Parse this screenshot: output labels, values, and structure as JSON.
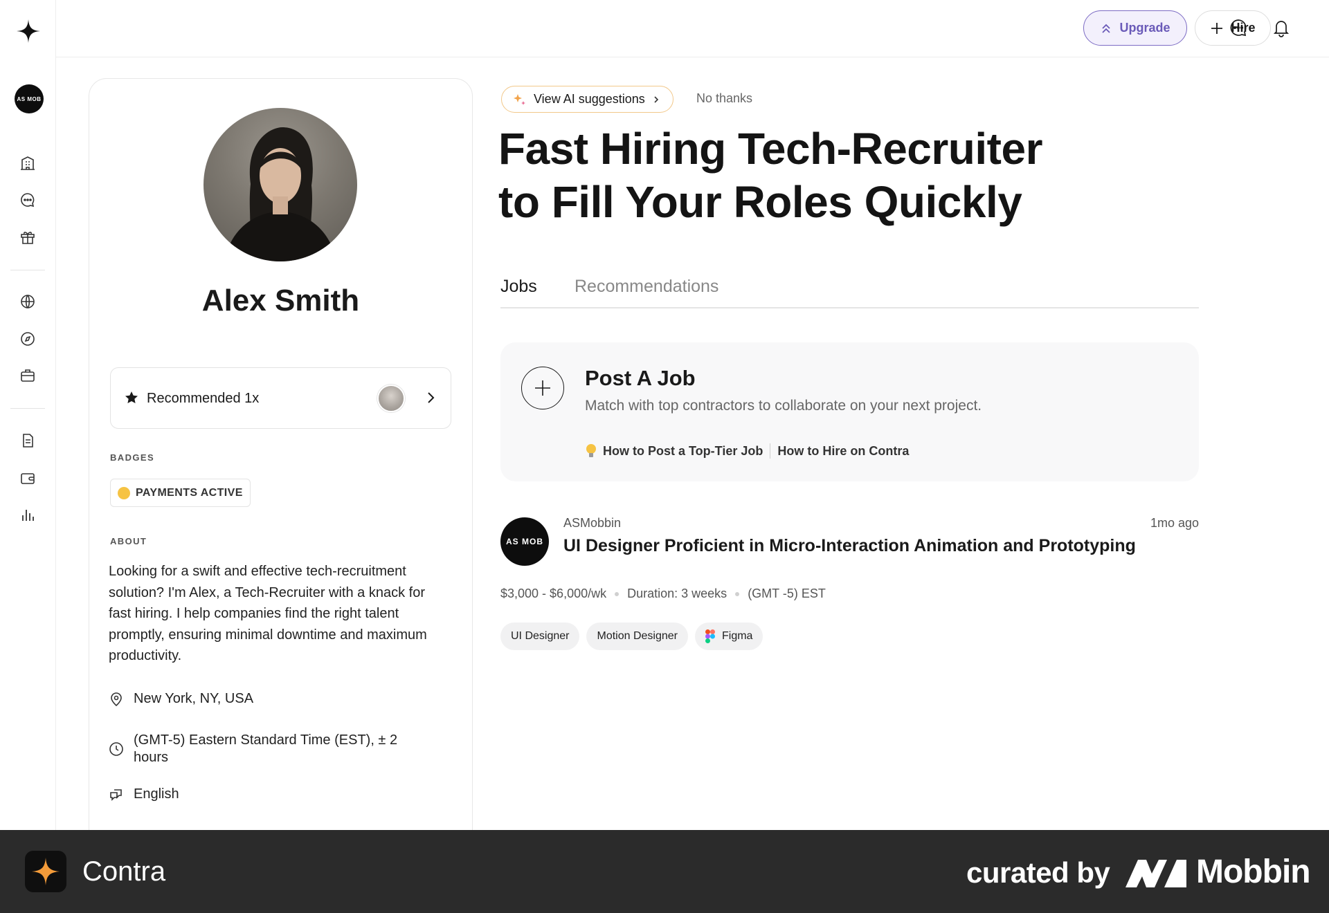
{
  "app": {
    "name": "Contra"
  },
  "rail": {
    "org_initials": "AS MOB",
    "items": [
      "building-icon",
      "chat-icon",
      "gift-icon",
      "globe-icon",
      "compass-icon",
      "briefcase-icon",
      "document-icon",
      "wallet-icon",
      "chart-icon"
    ]
  },
  "topbar": {
    "upgrade_label": "Upgrade",
    "hire_label": "Hire"
  },
  "profile": {
    "name": "Alex Smith",
    "recommended_label": "Recommended 1x",
    "badges_heading": "BADGES",
    "badge": "PAYMENTS ACTIVE",
    "about_heading": "ABOUT",
    "about": "Looking for a swift and effective tech-recruitment solution? I'm Alex, a Tech-Recruiter with a knack for fast hiring. I help companies find the right talent promptly, ensuring minimal downtime and maximum productivity.",
    "location": "New York, NY, USA",
    "timezone": "(GMT-5) Eastern Standard Time (EST), ± 2 hours",
    "language": "English"
  },
  "main": {
    "ai_suggestions_label": "View AI suggestions",
    "no_thanks_label": "No thanks",
    "headline_line1": "Fast Hiring Tech-Recruiter",
    "headline_line2": "to Fill Your Roles Quickly",
    "tabs": [
      {
        "label": "Jobs",
        "active": true
      },
      {
        "label": "Recommendations",
        "active": false
      }
    ],
    "post_job": {
      "title": "Post A Job",
      "subtitle": "Match with top contractors to collaborate on your next project.",
      "link1": "How to Post a Top-Tier Job",
      "link2": "How to Hire on Contra"
    },
    "job": {
      "company": "ASMobbin",
      "logo_text": "AS MOB",
      "posted": "1mo ago",
      "title": "UI Designer Proficient in Micro-Interaction Animation and Prototyping",
      "rate": "$3,000 - $6,000/wk",
      "duration": "Duration: 3 weeks",
      "timezone": "(GMT -5) EST",
      "tags": [
        "UI Designer",
        "Motion Designer",
        "Figma"
      ]
    }
  },
  "footer": {
    "app_name": "Contra",
    "curated_by": "curated by",
    "brand": "Mobbin"
  },
  "colors": {
    "accent_purple": "#7c6bc4",
    "ai_pill_border": "#f2c88a",
    "footer_bg": "#2b2b2b"
  }
}
